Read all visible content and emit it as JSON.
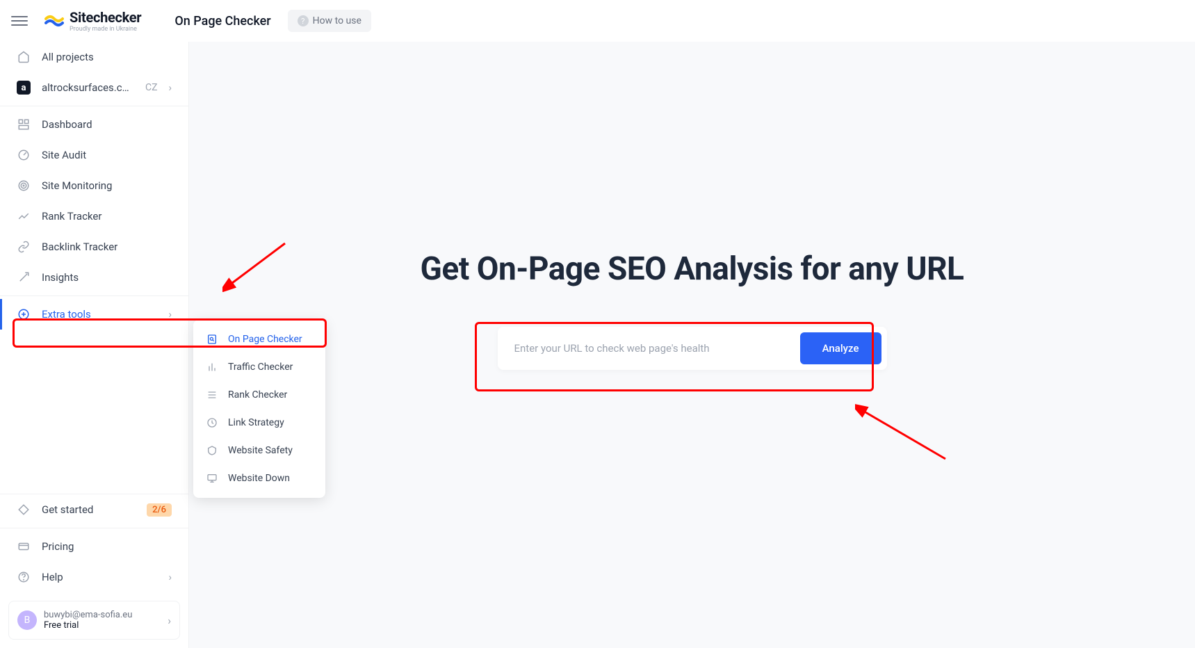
{
  "brand": {
    "title": "Sitechecker",
    "subtitle": "Proudly made in Ukraine"
  },
  "header": {
    "breadcrumb": "On Page Checker",
    "how_to_use": "How to use"
  },
  "sidebar": {
    "all_projects": "All projects",
    "project": {
      "name": "altrocksurfaces.co...",
      "country": "CZ",
      "icon_letter": "a"
    },
    "items": [
      {
        "label": "Dashboard"
      },
      {
        "label": "Site Audit"
      },
      {
        "label": "Site Monitoring"
      },
      {
        "label": "Rank Tracker"
      },
      {
        "label": "Backlink Tracker"
      },
      {
        "label": "Insights"
      },
      {
        "label": "Extra tools"
      }
    ],
    "get_started": {
      "label": "Get started",
      "badge": "2/6"
    },
    "pricing": "Pricing",
    "help": "Help"
  },
  "submenu": {
    "items": [
      {
        "label": "On Page Checker"
      },
      {
        "label": "Traffic Checker"
      },
      {
        "label": "Rank Checker"
      },
      {
        "label": "Link Strategy"
      },
      {
        "label": "Website Safety"
      },
      {
        "label": "Website Down"
      }
    ]
  },
  "user": {
    "email": "buwybi@ema-sofia.eu",
    "plan": "Free trial",
    "initial": "B"
  },
  "hero": {
    "title": "Get On-Page SEO Analysis for any URL",
    "placeholder": "Enter your URL to check web page's health",
    "button": "Analyze"
  }
}
